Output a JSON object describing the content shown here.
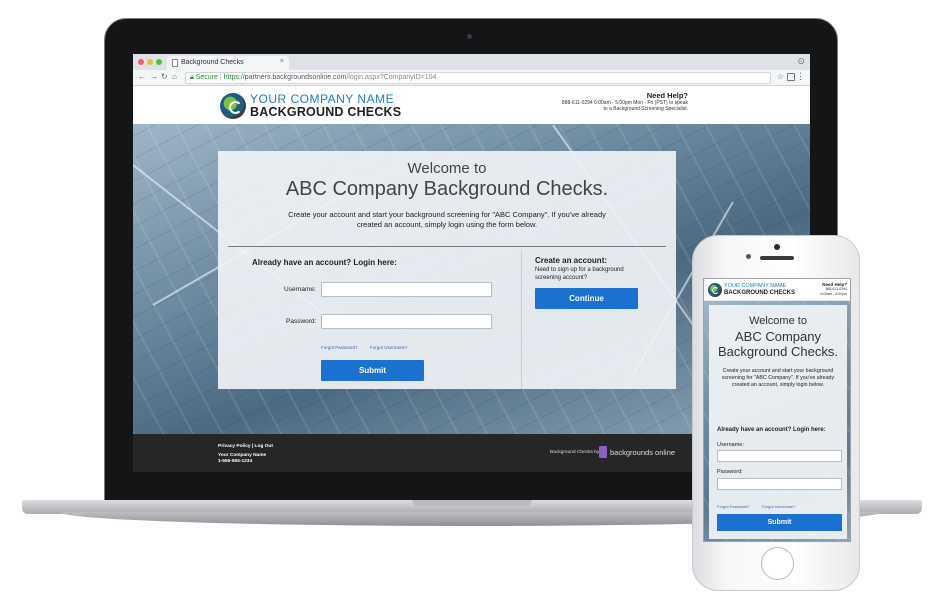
{
  "browser": {
    "tab_title": "Background Checks",
    "tab_close": "×",
    "secure_label": "Secure",
    "url_scheme": "https://",
    "url_host": "partners.backgroundsonline.com",
    "url_path": "/login.aspx?CompanyID=104"
  },
  "site": {
    "logo_top": "YOUR COMPANY NAME",
    "logo_bottom": "BACKGROUND CHECKS",
    "help_title": "Need Help?",
    "help_line1": "888-611-0294 6:00am - 5:00pm Mon - Fri (PST) to speak",
    "help_line2": "to a Background Screening Specialist."
  },
  "card": {
    "welcome": "Welcome to",
    "company": "ABC Company Background Checks.",
    "intro": "Create your account and start your background screening for \"ABC Company\". If you've already created an account, simply login using the form below.",
    "login_heading": "Already have an account? Login here:",
    "username_label": "Username:",
    "password_label": "Password:",
    "forgot_password": "Forgot Password?",
    "forgot_username": "Forgot Username?",
    "submit": "Submit",
    "create_heading": "Create an account:",
    "create_text": "Need to sign up for a background screening account?",
    "continue": "Continue"
  },
  "footer": {
    "links": "Privacy Policy | Log Out",
    "company_name": "Your Company Name",
    "company_phone": "1-555-555-1234",
    "powered_by": "Background Checks by:",
    "provider": "backgrounds online"
  },
  "mobile": {
    "logo_top": "YOUR COMPANY NAME",
    "logo_bottom": "BACKGROUND CHECKS",
    "help_title": "Need Help?",
    "help_line1": "888-611-0294",
    "help_line2": "6:00am - 5:00pm",
    "welcome": "Welcome to",
    "company": "ABC Company Background Checks.",
    "intro": "Create your account and start your background screening for \"ABC Company\". If you've already created an account, simply login below.",
    "login_heading": "Already have an account? Login here:",
    "username_label": "Username:",
    "password_label": "Password:",
    "forgot_password": "Forgot Password?",
    "forgot_username": "Forgot Username?",
    "submit": "Submit"
  },
  "colors": {
    "primary_button": "#1b71cf",
    "logo_blue": "#1a7fbf",
    "logo_green": "#7cc242",
    "footer_bg": "#262626",
    "secure_green": "#1b8f35",
    "provider_purple": "#8b5ec9"
  },
  "icons": [
    "close-dot-icon",
    "minimize-dot-icon",
    "maximize-dot-icon",
    "page-icon",
    "back-icon",
    "forward-icon",
    "reload-icon",
    "home-icon",
    "lock-icon",
    "star-icon",
    "extension-icon",
    "menu-icon",
    "user-icon"
  ]
}
